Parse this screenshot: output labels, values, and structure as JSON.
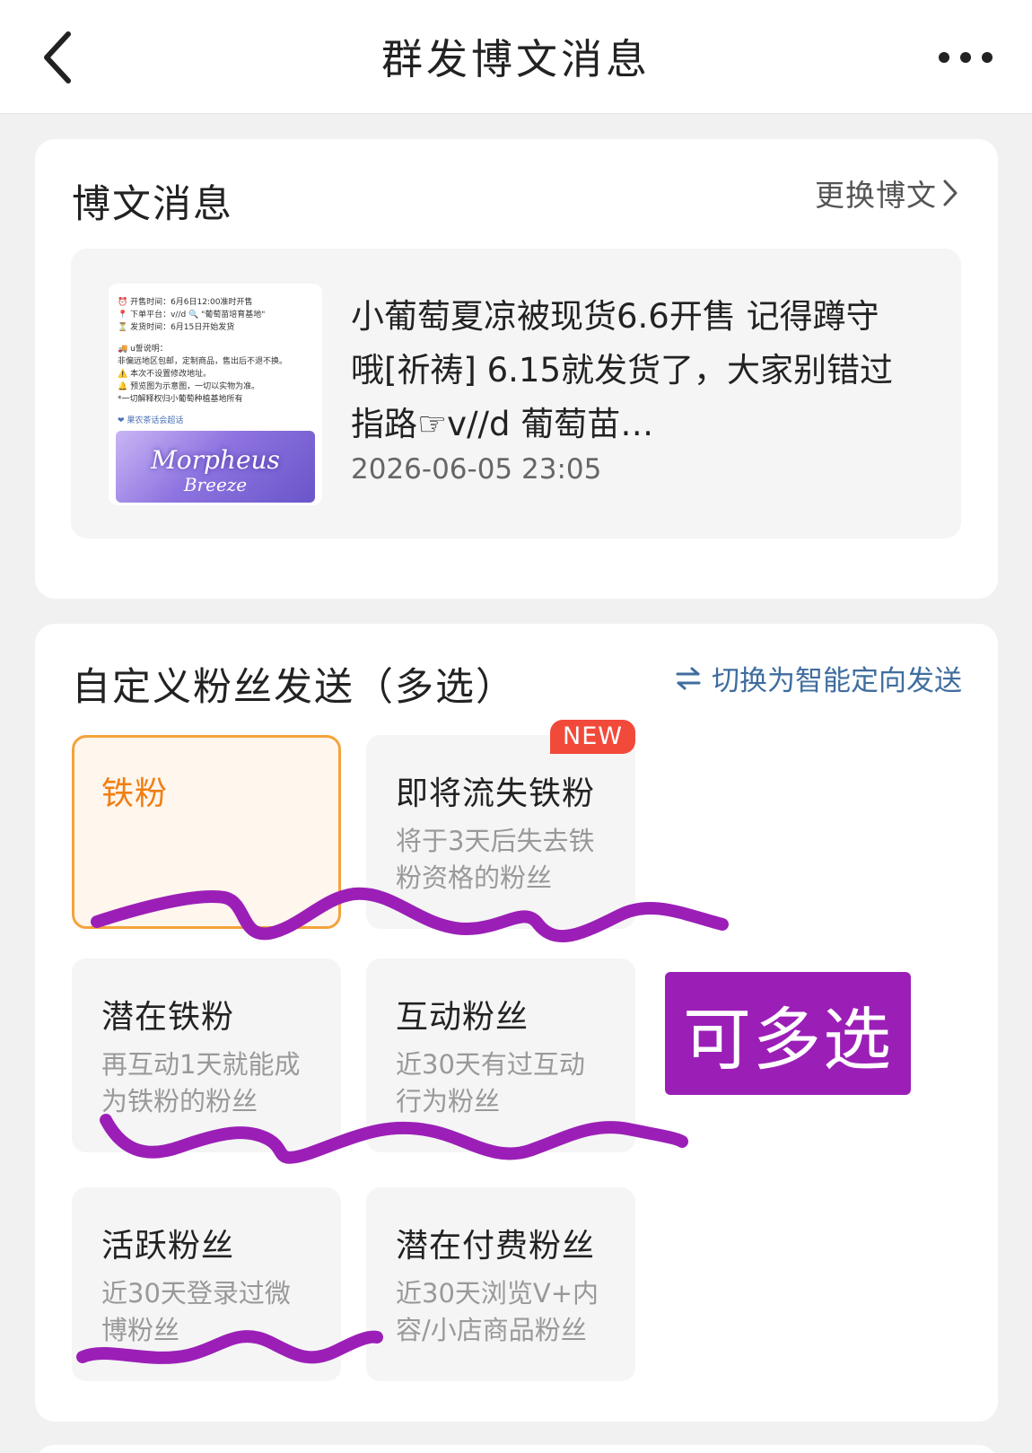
{
  "header": {
    "title": "群发博文消息",
    "back_icon": "chevron-left-icon",
    "more_icon": "more-dots-icon"
  },
  "post_section": {
    "title": "博文消息",
    "change_label": "更换博文",
    "post": {
      "text": "小葡萄夏凉被现货6.6开售 记得蹲守哦[祈祷] 6.15就发货了，大家别错过 指路☞v//d 葡萄苗…",
      "time": "2026-06-05 23:05",
      "thumb_lines": [
        "⏰ 开售时间：6月6日12:00准时开售",
        "📍 下单平台：v//d 🔍 \"葡萄苗培育基地\"",
        "⏳ 发货时间：6月15日开始发货",
        "",
        "🚚 u誓说明：",
        "非偏远地区包邮，定制商品，售出后不退不换。",
        "⚠️ 本次不设置修改地址。",
        "🔔 预览图为示意图，一切以实物为准。",
        "*一切解释权归小葡萄种植基地所有",
        "",
        "❤ 果农茶话会超话"
      ],
      "thumb_banner_title": "Morpheus",
      "thumb_banner_sub": "Breeze"
    }
  },
  "fans_section": {
    "title": "自定义粉丝发送（多选）",
    "switch_label": "切换为智能定向发送",
    "switch_icon": "swap-arrows-icon",
    "options": [
      {
        "title": "铁粉",
        "desc": "",
        "selected": true
      },
      {
        "title": "即将流失铁粉",
        "desc": "将于3天后失去铁粉资格的粉丝",
        "badge": "NEW"
      },
      {
        "title": "潜在铁粉",
        "desc": "再互动1天就能成为铁粉的粉丝"
      },
      {
        "title": "互动粉丝",
        "desc": "近30天有过互动行为粉丝"
      },
      {
        "title": "活跃粉丝",
        "desc": "近30天登录过微博粉丝"
      },
      {
        "title": "潜在付费粉丝",
        "desc": "近30天浏览V+内容/小店商品粉丝"
      }
    ]
  },
  "annotation": {
    "label": "可多选",
    "color": "#9b1fb7"
  },
  "colors": {
    "accent_orange": "#f07f12",
    "link_blue": "#3f6d9e",
    "badge_red": "#f24a3a"
  }
}
